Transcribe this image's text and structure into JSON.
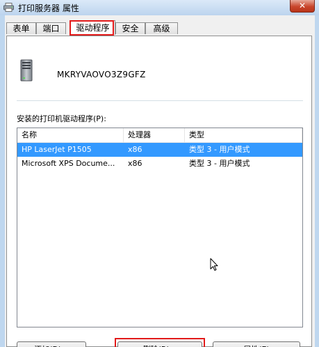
{
  "window": {
    "title": "打印服务器 属性",
    "close_label": "✕"
  },
  "tabs": [
    {
      "label": "表单",
      "active": false
    },
    {
      "label": "端口",
      "active": false
    },
    {
      "label": "驱动程序",
      "active": true
    },
    {
      "label": "安全",
      "active": false
    },
    {
      "label": "高级",
      "active": false
    }
  ],
  "server": {
    "name": "MKRYVAOVO3Z9GFZ"
  },
  "drivers": {
    "caption": "安装的打印机驱动程序(P):",
    "columns": [
      "名称",
      "处理器",
      "类型"
    ],
    "rows": [
      {
        "name": "HP LaserJet P1505",
        "processor": "x86",
        "type": "类型 3 - 用户模式",
        "selected": true
      },
      {
        "name": "Microsoft XPS Docume...",
        "processor": "x86",
        "type": "类型 3 - 用户模式",
        "selected": false
      }
    ]
  },
  "buttons": {
    "add": "添加(D)...",
    "remove": "删除(R)...",
    "properties": "属性(E)"
  },
  "colors": {
    "selection": "#3399ff",
    "highlight_box": "#e21a1a",
    "title_bar": "#bfd7ef"
  }
}
